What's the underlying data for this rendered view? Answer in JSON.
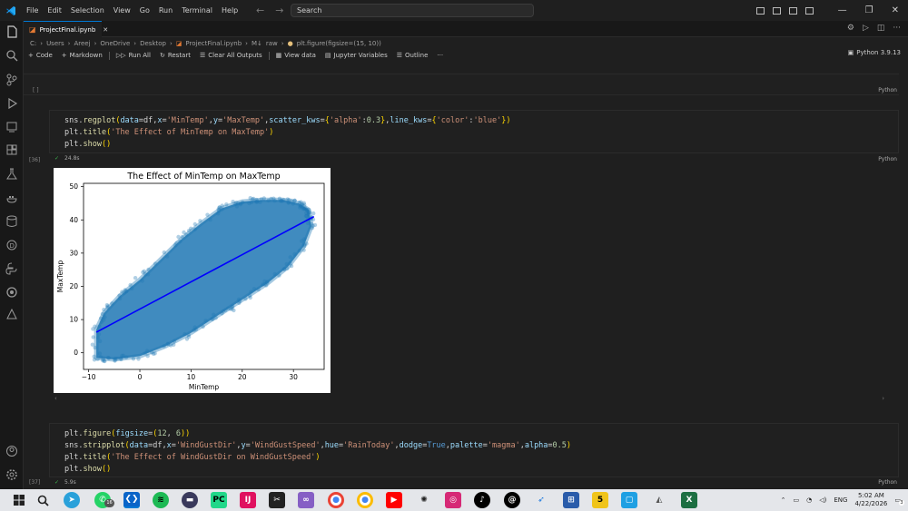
{
  "window": {
    "menus": [
      "File",
      "Edit",
      "Selection",
      "View",
      "Go",
      "Run",
      "Terminal",
      "Help"
    ],
    "search_label": "Search"
  },
  "tab": {
    "title": "ProjectFinal.ipynb"
  },
  "breadcrumb": [
    "C:",
    "Users",
    "Areej",
    "OneDrive",
    "Desktop",
    "ProjectFinal.ipynb",
    "raw",
    "plt.figure(figsize=(15, 10))"
  ],
  "toolbar": {
    "code": "Code",
    "markdown": "Markdown",
    "run_all": "Run All",
    "restart": "Restart",
    "clear_outputs": "Clear All Outputs",
    "view_data": "View data",
    "variables": "Jupyter Variables",
    "outline": "Outline",
    "more": "···",
    "kernel": "Python 3.9.13"
  },
  "cells": {
    "empty": {
      "gutter": "[ ]",
      "lang": "Python"
    },
    "cell1": {
      "gutter": "[36]",
      "lines": [
        "sns.regplot(data=df,x='MinTemp',y='MaxTemp',scatter_kws={'alpha':0.3},line_kws={'color':'blue'})",
        "plt.title('The Effect of MinTemp on MaxTemp')",
        "plt.show()"
      ],
      "time": "24.8s",
      "lang": "Python"
    },
    "cell2": {
      "gutter": "[37]",
      "lines": [
        "plt.figure(figsize=(12, 6))",
        "sns.stripplot(data=df,x='WindGustDir',y='WindGustSpeed',hue='RainToday',dodge=True,palette='magma',alpha=0.5)",
        "plt.title('The Effect of WindGustDir on WindGustSpeed')",
        "plt.show()"
      ],
      "time": "5.9s",
      "lang": "Python"
    }
  },
  "chart_data": {
    "type": "scatter",
    "title": "The Effect of MinTemp on MaxTemp",
    "xlabel": "MinTemp",
    "ylabel": "MaxTemp",
    "xlim": [
      -11,
      36
    ],
    "ylim": [
      -5,
      51
    ],
    "xticks": [
      -10,
      0,
      10,
      20,
      30
    ],
    "yticks": [
      0,
      10,
      20,
      30,
      40,
      50
    ],
    "scatter_color": "#1f77b4",
    "line_color": "#0000ff",
    "regression_line": {
      "x": [
        -8.5,
        34.0
      ],
      "y": [
        6.2,
        41.0
      ]
    },
    "cloud_outline": [
      [
        -8.5,
        -1.5
      ],
      [
        -5,
        -2
      ],
      [
        0,
        -1
      ],
      [
        5,
        2
      ],
      [
        10,
        6
      ],
      [
        15,
        11
      ],
      [
        20,
        16
      ],
      [
        25,
        21
      ],
      [
        29,
        26
      ],
      [
        32,
        32
      ],
      [
        33.5,
        38
      ],
      [
        33,
        43
      ],
      [
        31,
        45
      ],
      [
        28,
        46
      ],
      [
        24,
        46
      ],
      [
        20,
        45.5
      ],
      [
        16,
        43.5
      ],
      [
        12,
        39
      ],
      [
        8,
        34
      ],
      [
        4,
        28
      ],
      [
        0,
        22
      ],
      [
        -4,
        17
      ],
      [
        -7,
        12
      ],
      [
        -8.5,
        7
      ]
    ]
  },
  "taskbar": {
    "whatsapp_badge": "16",
    "tray_lang": "ENG",
    "time": "5:02 AM",
    "date": "4/22/2026",
    "notif": "3"
  }
}
